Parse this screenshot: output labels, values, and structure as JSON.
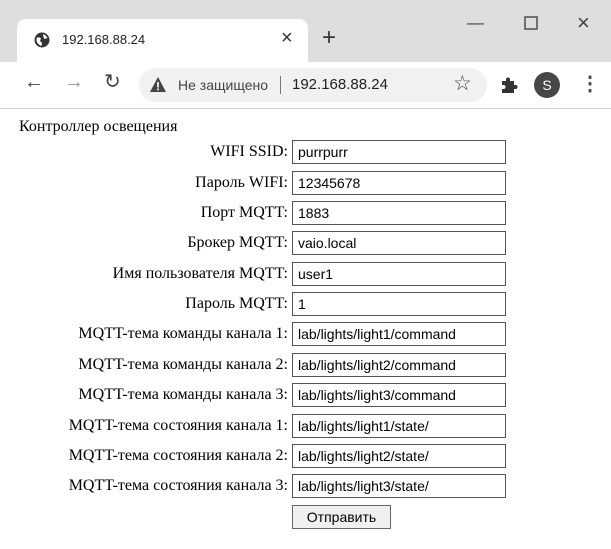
{
  "browser": {
    "tab_title": "192.168.88.24",
    "insecure_label": "Не защищено",
    "url": "192.168.88.24",
    "profile_initial": "S"
  },
  "page": {
    "heading": "Контроллер освещения",
    "fields": [
      {
        "label": "WIFI SSID:",
        "value": "purrpurr"
      },
      {
        "label": "Пароль WIFI:",
        "value": "12345678"
      },
      {
        "label": "Порт MQTT:",
        "value": "1883"
      },
      {
        "label": "Брокер MQTT:",
        "value": "vaio.local"
      },
      {
        "label": "Имя пользователя MQTT:",
        "value": "user1"
      },
      {
        "label": "Пароль MQTT:",
        "value": "1"
      },
      {
        "label": "MQTT-тема команды канала 1:",
        "value": "lab/lights/light1/command"
      },
      {
        "label": "MQTT-тема команды канала 2:",
        "value": "lab/lights/light2/command"
      },
      {
        "label": "MQTT-тема команды канала 3:",
        "value": "lab/lights/light3/command"
      },
      {
        "label": "MQTT-тема состояния канала 1:",
        "value": "lab/lights/light1/state/"
      },
      {
        "label": "MQTT-тема состояния канала 2:",
        "value": "lab/lights/light2/state/"
      },
      {
        "label": "MQTT-тема состояния канала 3:",
        "value": "lab/lights/light3/state/"
      }
    ],
    "submit_label": "Отправить"
  }
}
